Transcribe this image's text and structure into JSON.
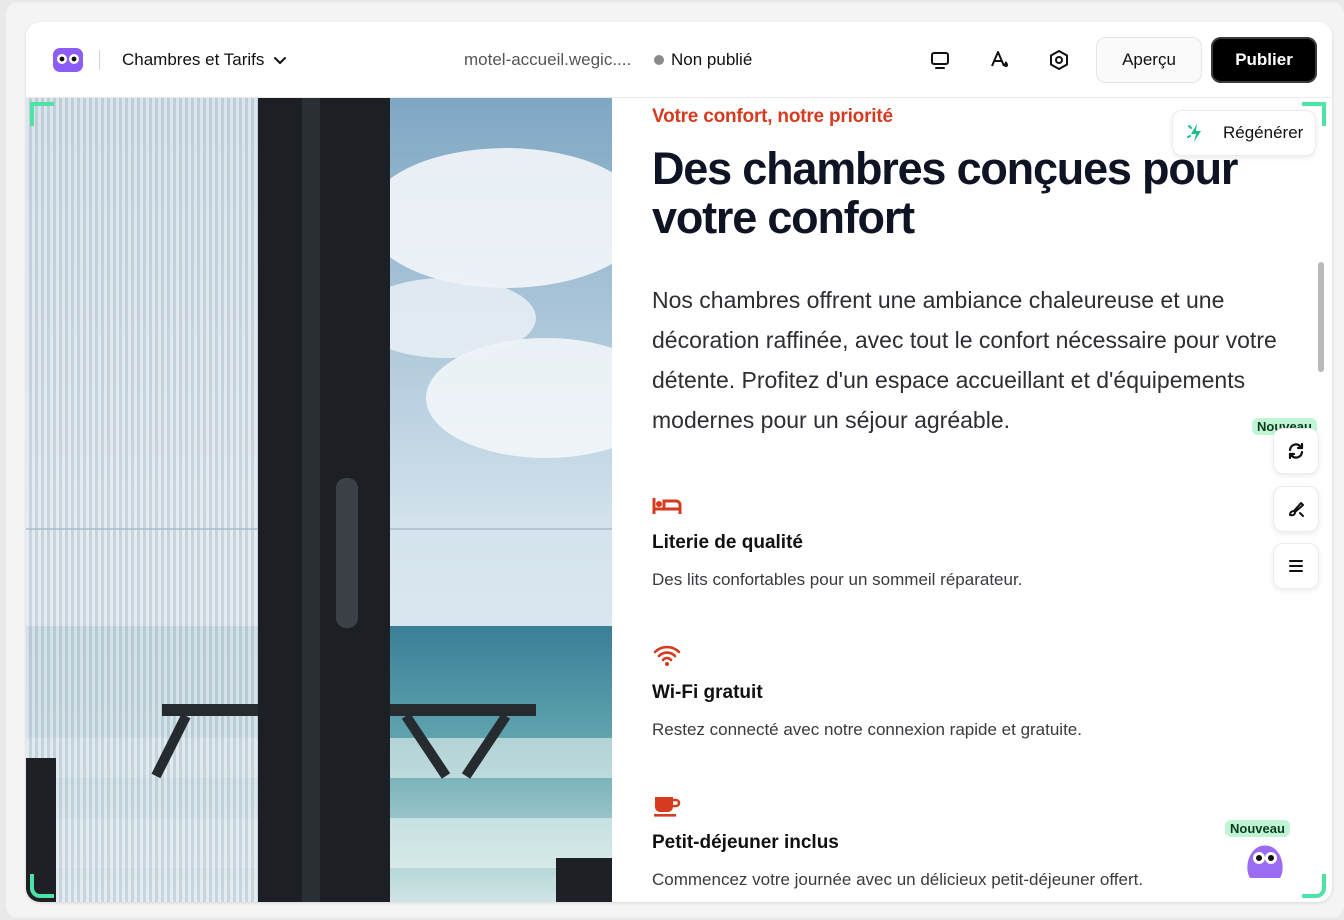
{
  "header": {
    "page_selector": "Chambres et Tarifs",
    "url": "motel-accueil.wegic....",
    "status": "Non publié",
    "preview_label": "Aperçu",
    "publish_label": "Publier"
  },
  "toolbar": {
    "icons": [
      "monitor-icon",
      "font-color-icon",
      "settings-icon"
    ]
  },
  "main": {
    "eyebrow": "Votre confort, notre priorité",
    "headline": "Des chambres conçues pour votre confort",
    "lead": "Nos chambres offrent une ambiance chaleureuse et une décoration raffinée, avec tout le confort nécessaire pour votre détente. Profitez d'un espace accueillant et d'équipements modernes pour un séjour agréable.",
    "features": [
      {
        "icon": "bed-icon",
        "title": "Literie de qualité",
        "desc": "Des lits confortables pour un sommeil réparateur."
      },
      {
        "icon": "wifi-icon",
        "title": "Wi-Fi gratuit",
        "desc": "Restez connecté avec notre connexion rapide et gratuite."
      },
      {
        "icon": "coffee-cup-icon",
        "title": "Petit-déjeuner inclus",
        "desc": "Commencez votre journée avec un délicieux petit-déjeuner offert."
      }
    ]
  },
  "floating": {
    "regenerate_label": "Régénérer",
    "badge_new": "Nouveau",
    "badge_new_mascot": "Nouveau"
  },
  "colors": {
    "accent": "#d63b1f",
    "heading": "#0f1424",
    "badge_bg": "#bff5d4",
    "frame_corners": "#4ee3a4"
  }
}
